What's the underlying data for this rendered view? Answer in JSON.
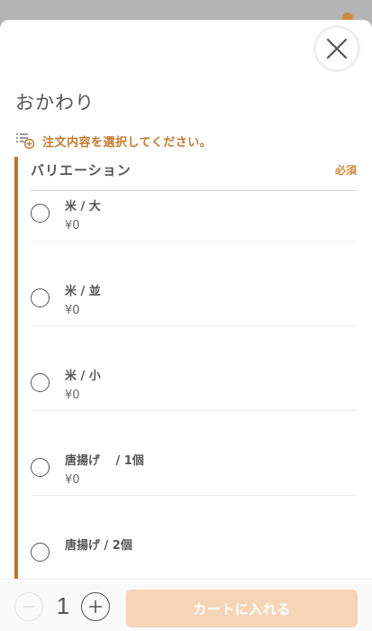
{
  "colors": {
    "accent": "#c6731f",
    "accent_text": "#c7782c",
    "cart_button_bg": "#f5d5b6"
  },
  "modal": {
    "title": "おかわり",
    "instruction": "注文内容を選択してください。",
    "close_icon": "close-icon",
    "instruction_icon": "list-add-icon"
  },
  "group": {
    "title": "バリエーション",
    "required": "必須",
    "options": [
      {
        "name": "米 / 大",
        "price": "¥0"
      },
      {
        "name": "米 / 並",
        "price": "¥0"
      },
      {
        "name": "米 / 小",
        "price": "¥0"
      },
      {
        "name": "唐揚げ　 / 1個",
        "price": "¥0"
      },
      {
        "name": "唐揚げ / 2個",
        "price": ""
      }
    ]
  },
  "footer": {
    "quantity": "1",
    "cart_button": "カートに入れる"
  }
}
